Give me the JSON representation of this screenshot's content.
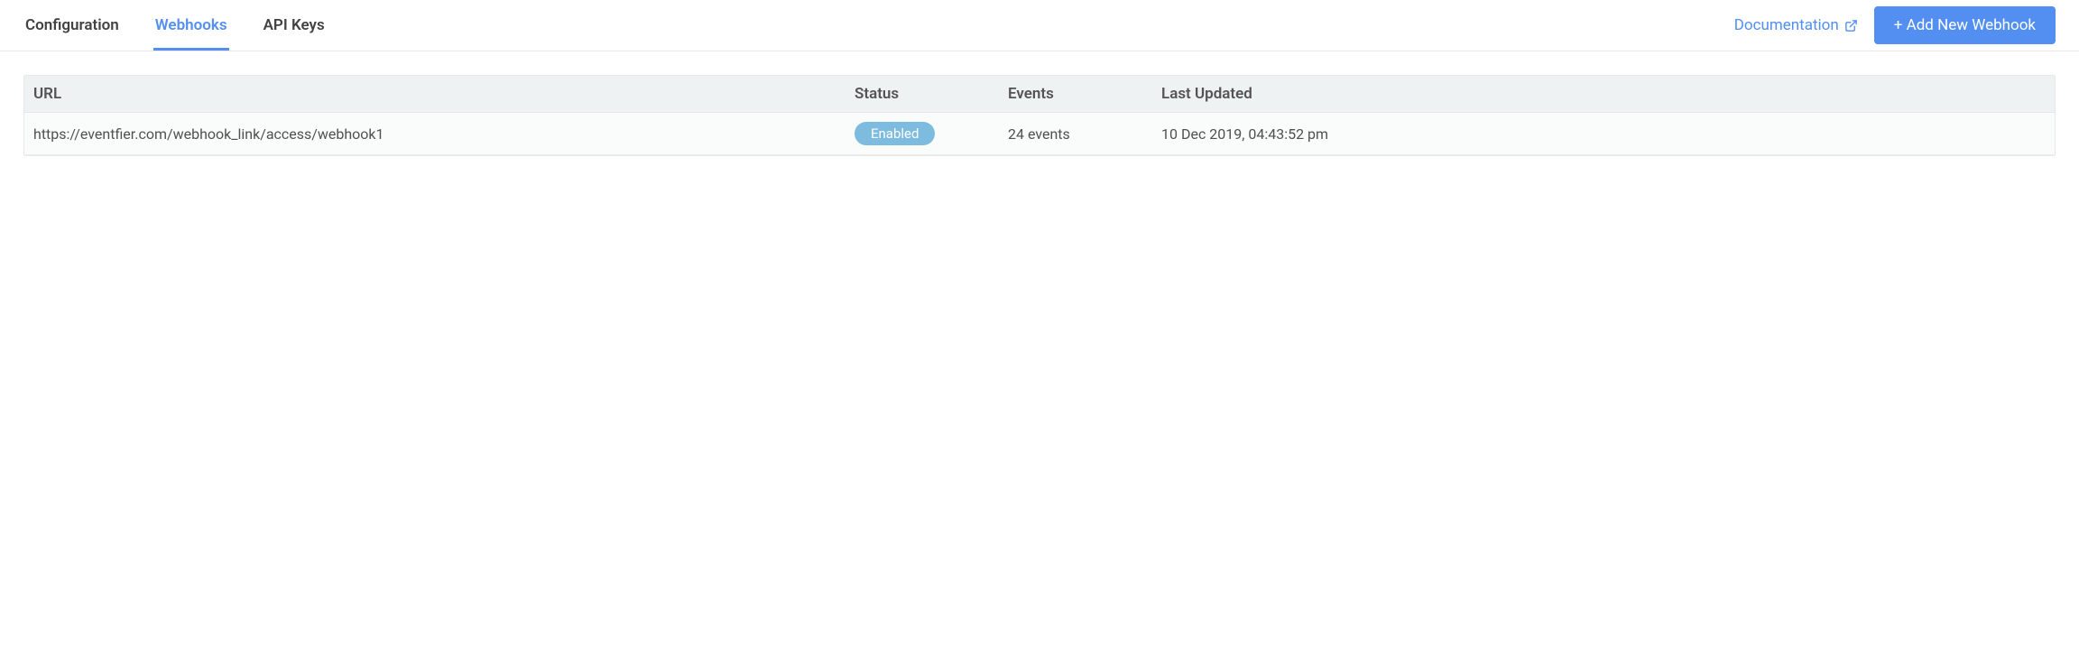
{
  "tabs": {
    "configuration": "Configuration",
    "webhooks": "Webhooks",
    "api_keys": "API Keys"
  },
  "actions": {
    "documentation": "Documentation",
    "add_webhook": "+ Add New Webhook"
  },
  "table": {
    "headers": {
      "url": "URL",
      "status": "Status",
      "events": "Events",
      "last_updated": "Last Updated"
    },
    "rows": [
      {
        "url": "https://eventfier.com/webhook_link/access/webhook1",
        "status": "Enabled",
        "events": "24 events",
        "last_updated": "10 Dec 2019, 04:43:52 pm"
      }
    ]
  }
}
